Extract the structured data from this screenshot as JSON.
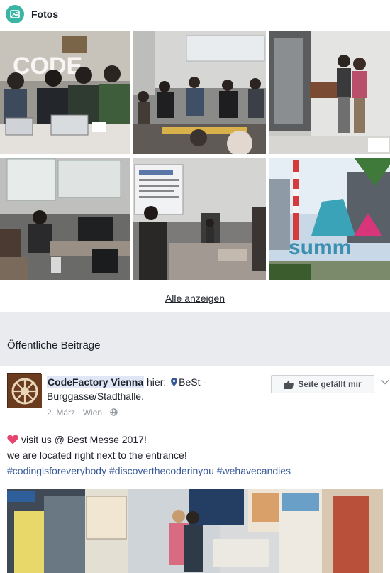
{
  "photos": {
    "title": "Fotos",
    "see_all": "Alle anzeigen",
    "overlay_text": "CODE"
  },
  "public_posts": {
    "title": "Öffentliche Beiträge"
  },
  "post": {
    "author": "CodeFactory Vienna",
    "location_prefix": "hier:",
    "location": "BeSt - Burggasse/Stadthalle.",
    "date": "2. März",
    "city": "Wien",
    "like_button": "Seite gefällt mir",
    "line1": "visit us @ Best Messe 2017!",
    "line2": "we are located right next to the entrance!",
    "hashtags": [
      "#codingisforeverybody",
      "#discoverthecoderinyou",
      "#wehavecandies"
    ]
  }
}
